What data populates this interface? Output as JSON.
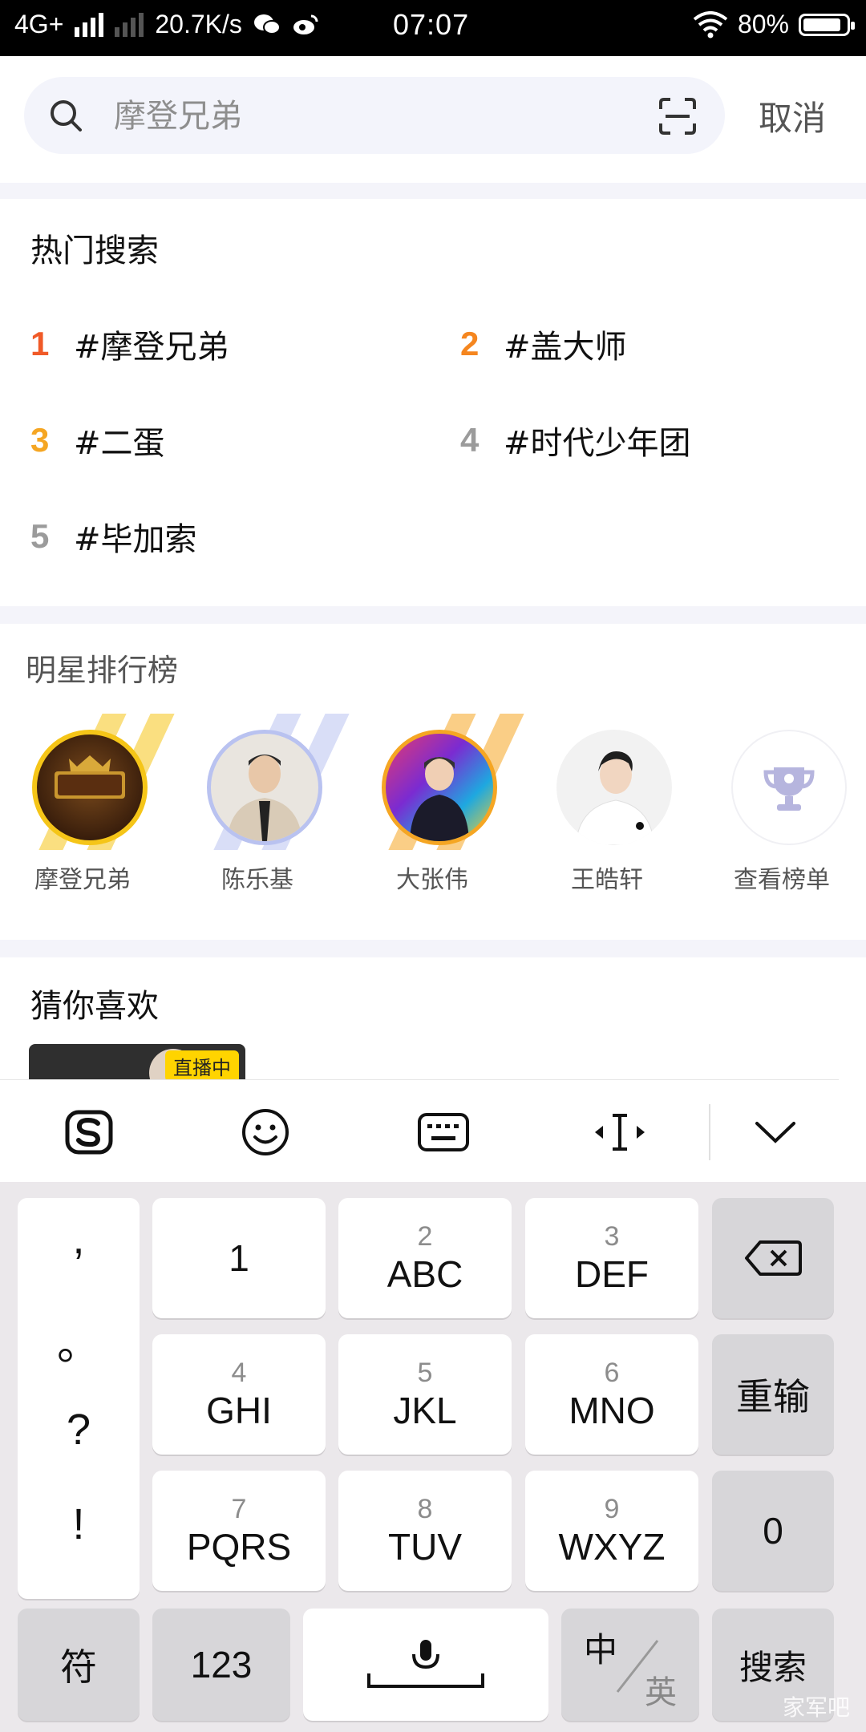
{
  "status_bar": {
    "network": "4G+",
    "speed": "20.7K/s",
    "time": "07:07",
    "battery": "80%"
  },
  "search": {
    "placeholder": "摩登兄弟",
    "cancel_label": "取消"
  },
  "hot_search": {
    "title": "热门搜索",
    "items": [
      {
        "rank": "1",
        "text": "#摩登兄弟",
        "color": "#f05a28"
      },
      {
        "rank": "2",
        "text": "#盖大师",
        "color": "#f5861f"
      },
      {
        "rank": "3",
        "text": "#二蛋",
        "color": "#f5a623"
      },
      {
        "rank": "4",
        "text": "#时代少年团",
        "color": "#9b9b9b"
      },
      {
        "rank": "5",
        "text": "#毕加索",
        "color": "#9b9b9b"
      }
    ]
  },
  "star_ranking": {
    "title": "明星排行榜",
    "stars": [
      {
        "name": "摩登兄弟",
        "ring": "#f5c518",
        "stripe": "#f5c518"
      },
      {
        "name": "陈乐基",
        "ring": "#b9c2f0",
        "stripe": "#b9c2f0"
      },
      {
        "name": "大张伟",
        "ring": "#f5a623",
        "stripe": "#f5a623"
      },
      {
        "name": "王皓轩",
        "ring": "#ffffff",
        "stripe": ""
      }
    ],
    "view_all_label": "查看榜单"
  },
  "guess": {
    "title": "猜你喜欢",
    "live_badge": "直播中"
  },
  "keyboard": {
    "punctuation": [
      ",",
      "。",
      "?",
      "!"
    ],
    "keys": [
      {
        "num": "",
        "letters": "1"
      },
      {
        "num": "2",
        "letters": "ABC"
      },
      {
        "num": "3",
        "letters": "DEF"
      },
      {
        "num": "4",
        "letters": "GHI"
      },
      {
        "num": "5",
        "letters": "JKL"
      },
      {
        "num": "6",
        "letters": "MNO"
      },
      {
        "num": "7",
        "letters": "PQRS"
      },
      {
        "num": "8",
        "letters": "TUV"
      },
      {
        "num": "9",
        "letters": "WXYZ"
      }
    ],
    "reenter_label": "重输",
    "zero_label": "0",
    "symbols_label": "符",
    "numbers_label": "123",
    "lang_zh": "中",
    "lang_en": "英",
    "search_label": "搜索"
  },
  "watermark": "家军吧"
}
